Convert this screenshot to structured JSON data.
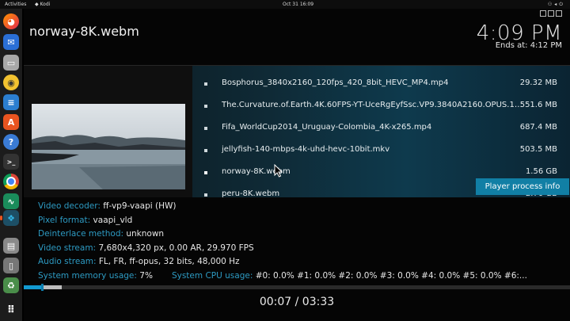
{
  "topbar": {
    "activities": "Activities",
    "app_name": "Kodi",
    "clock": "Oct 31  16:09",
    "tray_icons": [
      "network-icon",
      "volume-icon",
      "power-icon"
    ]
  },
  "dock": {
    "apps": [
      "firefox",
      "thunderbird",
      "files",
      "rhythmbox",
      "libreoffice-writer",
      "ubuntu-software",
      "help",
      "terminal",
      "chrome",
      "system-monitor",
      "kodi",
      "disk",
      "usb-drive",
      "trash",
      "show-applications"
    ]
  },
  "window": {
    "controls": [
      "minimize",
      "maximize",
      "close"
    ]
  },
  "player": {
    "title": "norway-8K.webm",
    "clock": "4:09 PM",
    "ends_at": "Ends at: 4:12 PM",
    "elapsed": "00:07 / 03:33",
    "played_fraction": 0.033,
    "buffered_fraction": 0.07
  },
  "files": [
    {
      "name": "Bosphorus_3840x2160_120fps_420_8bit_HEVC_MP4.mp4",
      "size": "29.32 MB"
    },
    {
      "name": "The.Curvature.of.Earth.4K.60FPS-YT-UceRgEyfSsc.VP9.3840Ã2160.OPUS.160...",
      "size": "551.6 MB"
    },
    {
      "name": "Fifa_WorldCup2014_Uruguay-Colombia_4K-x265.mp4",
      "size": "687.4 MB"
    },
    {
      "name": "jellyfish-140-mbps-4k-uhd-hevc-10bit.mkv",
      "size": "503.5 MB"
    },
    {
      "name": "norway-8K.webm",
      "size": "1.56 GB"
    },
    {
      "name": "peru-8K.webm",
      "size": "2.70 GB"
    }
  ],
  "tooltip": "Player process info",
  "info": {
    "decoder_label": "Video decoder:",
    "decoder_value": "ff-vp9-vaapi (HW)",
    "pixel_label": "Pixel format:",
    "pixel_value": "vaapi_vld",
    "deinterlace_label": "Deinterlace method:",
    "deinterlace_value": "unknown",
    "video_label": "Video stream:",
    "video_value": "7,680x4,320 px, 0.00 AR, 29.970 FPS",
    "audio_label": "Audio stream:",
    "audio_value": "FL, FR, ff-opus, 32 bits, 48,000 Hz",
    "mem_label": "System memory usage:",
    "mem_value": "7%",
    "cpu_label": "System CPU usage:",
    "cpu_value": "#0: 0.0% #1: 0.0% #2: 0.0% #3: 0.0% #4: 0.0% #5: 0.0% #6:..."
  },
  "colors": {
    "accent": "#129ad1",
    "label": "#2d9ac2",
    "tooltip_bg": "#117fa5"
  }
}
